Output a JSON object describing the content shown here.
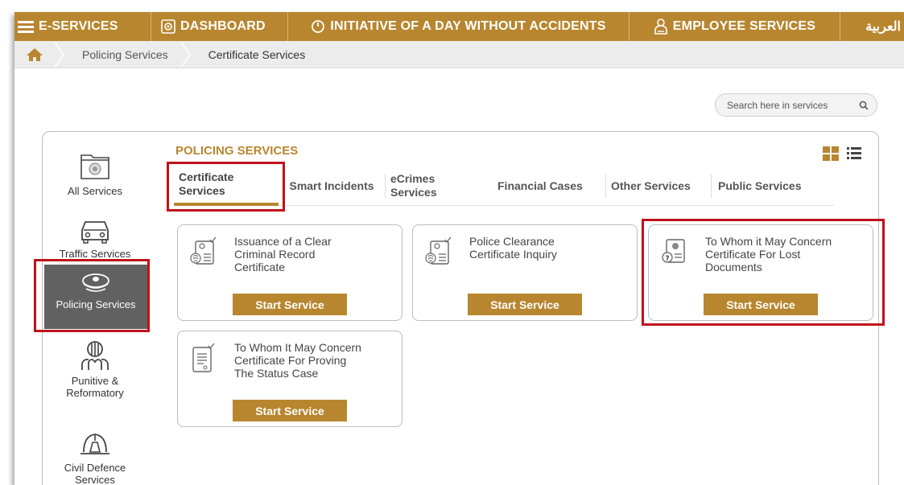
{
  "colors": {
    "brand": "#b8862f",
    "highlight": "#c0121a",
    "active_category": "#616161"
  },
  "topnav": {
    "eservices": "E-SERVICES",
    "dashboard": "DASHBOARD",
    "initiative": "INITIATIVE OF A DAY WITHOUT ACCIDENTS",
    "employee": "EMPLOYEE SERVICES",
    "language": "العربية"
  },
  "breadcrumb": {
    "items": [
      "Policing Services",
      "Certificate Services"
    ]
  },
  "search": {
    "placeholder": "Search here in services"
  },
  "categories": [
    {
      "label": "All Services",
      "icon": "folder-emblem-icon"
    },
    {
      "label": "Traffic Services",
      "icon": "car-icon"
    },
    {
      "label": "Policing Services",
      "icon": "police-cap-icon"
    },
    {
      "label_line1": "Punitive &",
      "label_line2": "Reformatory",
      "icon": "prison-icon"
    },
    {
      "label_line1": "Civil Defence",
      "label_line2": "Services",
      "icon": "fire-helmet-icon"
    }
  ],
  "section": {
    "title": "POLICING SERVICES"
  },
  "tabs": [
    {
      "line1": "Certificate",
      "line2": "Services"
    },
    {
      "label": "Smart Incidents"
    },
    {
      "line1": "eCrimes",
      "line2": "Services"
    },
    {
      "label": "Financial Cases"
    },
    {
      "label": "Other Services"
    },
    {
      "label": "Public Services"
    }
  ],
  "services": [
    {
      "line1": "Issuance of a Clear",
      "line2": "Criminal Record",
      "line3": "Certificate",
      "button": "Start Service"
    },
    {
      "line1": "Police Clearance",
      "line2": "Certificate Inquiry",
      "button": "Start Service"
    },
    {
      "line1": "To Whom it May Concern",
      "line2": "Certificate For Lost",
      "line3": "Documents",
      "button": "Start Service"
    },
    {
      "line1": "To Whom It May Concern",
      "line2": "Certificate For Proving",
      "line3": "The Status Case",
      "button": "Start Service"
    }
  ]
}
